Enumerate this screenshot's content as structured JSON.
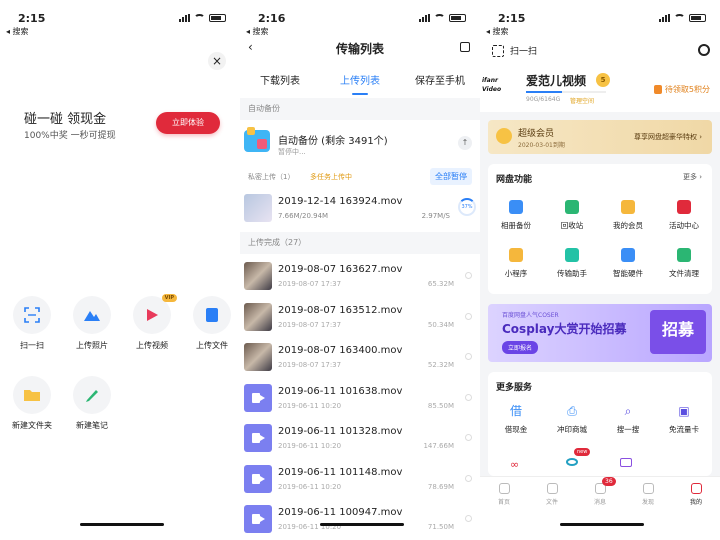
{
  "colors": {
    "accent_blue": "#2a7ff6",
    "accent_red": "#e02a3b",
    "gold": "#f7c244"
  },
  "panel1": {
    "time": "2:15",
    "back_label": "◂ 搜索",
    "close": "×",
    "promo_title": "碰一碰 领现金",
    "promo_sub": "100%中奖 一秒可提现",
    "try_button": "立即体验",
    "vip_tag": "VIP",
    "actions": [
      {
        "label": "扫一扫",
        "icon": "scan-icon"
      },
      {
        "label": "上传照片",
        "icon": "mountain-photo-icon"
      },
      {
        "label": "上传视频",
        "icon": "play-video-icon"
      },
      {
        "label": "上传文件",
        "icon": "file-icon"
      },
      {
        "label": "新建文件夹",
        "icon": "folder-icon"
      },
      {
        "label": "新建笔记",
        "icon": "pen-icon"
      }
    ]
  },
  "panel2": {
    "time": "2:16",
    "back_label": "◂ 搜索",
    "title": "传输列表",
    "back_arrow": "‹",
    "tabs": [
      "下载列表",
      "上传列表",
      "保存至手机"
    ],
    "auto_backup_section": "自动备份",
    "auto_backup_title": "自动备份 (剩余 3491个)",
    "auto_backup_status": "暂停中...",
    "up_arrow": "↑",
    "private_upload": "私密上传（1）",
    "multitask": "多任务上传中",
    "pause_all": "全部暂停",
    "uploading": {
      "name": "2019-12-14 163924.mov",
      "size": "7.66M/20.94M",
      "speed": "2.97M/S",
      "percent": "37%"
    },
    "done_section": "上传完成（27）",
    "completed": [
      {
        "name": "2019-08-07 163627.mov",
        "date": "2019-08-07 17:37",
        "size": "65.32M",
        "thumb": "photo"
      },
      {
        "name": "2019-08-07 163512.mov",
        "date": "2019-08-07 17:37",
        "size": "50.34M",
        "thumb": "photo"
      },
      {
        "name": "2019-08-07 163400.mov",
        "date": "2019-08-07 17:37",
        "size": "52.32M",
        "thumb": "photo"
      },
      {
        "name": "2019-06-11 101638.mov",
        "date": "2019-06-11 10:20",
        "size": "85.50M",
        "thumb": "video"
      },
      {
        "name": "2019-06-11 101328.mov",
        "date": "2019-06-11 10:20",
        "size": "147.66M",
        "thumb": "video"
      },
      {
        "name": "2019-06-11 101148.mov",
        "date": "2019-06-11 10:20",
        "size": "78.69M",
        "thumb": "video"
      },
      {
        "name": "2019-06-11 100947.mov",
        "date": "2019-06-11 10:20",
        "size": "71.50M",
        "thumb": "video"
      }
    ]
  },
  "panel3": {
    "time": "2:15",
    "back_label": "◂ 搜索",
    "scan": "扫一扫",
    "logo_text": "ifanr Video",
    "username": "爱范儿视频",
    "level": "5",
    "quota": "90G/6164G",
    "manage": "管理空间",
    "points": "待领取5积分",
    "quota_used_fraction": 0.45,
    "vip_title": "超级会员",
    "vip_date": "2020-03-01到期",
    "vip_right": "尊享网盘超豪华特权 ›",
    "func_title": "网盘功能",
    "func_more": "更多 ›",
    "functions": [
      {
        "label": "相册备份",
        "color": "#3a8ef6"
      },
      {
        "label": "回收站",
        "color": "#2bb673"
      },
      {
        "label": "我的会员",
        "color": "#f5b73c"
      },
      {
        "label": "活动中心",
        "color": "#e02a3b"
      },
      {
        "label": "小程序",
        "color": "#f5b73c"
      },
      {
        "label": "传输助手",
        "color": "#23c2a6"
      },
      {
        "label": "智能硬件",
        "color": "#3a8ef6"
      },
      {
        "label": "文件清理",
        "color": "#2bb673"
      }
    ],
    "banner_small": "百度网盘人气COSER",
    "banner_big": "Cosplay大赏开始招募",
    "banner_btn": "立即报名",
    "banner_stamp": "招募",
    "more_services": "更多服务",
    "services": [
      {
        "label": "借现金",
        "color": "#3a8ef6",
        "glyph": "借"
      },
      {
        "label": "冲印商城",
        "color": "#3a8ef6",
        "glyph": "⎙"
      },
      {
        "label": "搜一搜",
        "color": "#5b4fe0",
        "glyph": "⌕"
      },
      {
        "label": "免流量卡",
        "color": "#5b4fe0",
        "glyph": "▣"
      }
    ],
    "new_badge": "new",
    "tabs": [
      "首页",
      "文件",
      "消息",
      "发现",
      "我的"
    ],
    "msg_badge": "36"
  }
}
